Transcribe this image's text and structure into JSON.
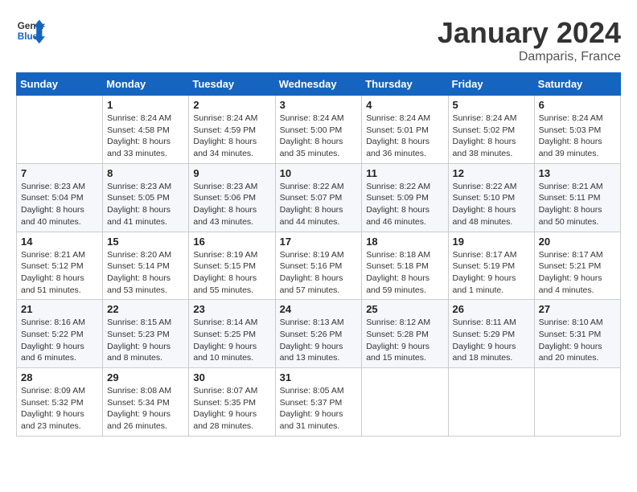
{
  "logo": {
    "general": "General",
    "blue": "Blue"
  },
  "header": {
    "month": "January 2024",
    "location": "Damparis, France"
  },
  "weekdays": [
    "Sunday",
    "Monday",
    "Tuesday",
    "Wednesday",
    "Thursday",
    "Friday",
    "Saturday"
  ],
  "weeks": [
    [
      {
        "day": null,
        "sunrise": null,
        "sunset": null,
        "daylight": null
      },
      {
        "day": "1",
        "sunrise": "Sunrise: 8:24 AM",
        "sunset": "Sunset: 4:58 PM",
        "daylight": "Daylight: 8 hours and 33 minutes."
      },
      {
        "day": "2",
        "sunrise": "Sunrise: 8:24 AM",
        "sunset": "Sunset: 4:59 PM",
        "daylight": "Daylight: 8 hours and 34 minutes."
      },
      {
        "day": "3",
        "sunrise": "Sunrise: 8:24 AM",
        "sunset": "Sunset: 5:00 PM",
        "daylight": "Daylight: 8 hours and 35 minutes."
      },
      {
        "day": "4",
        "sunrise": "Sunrise: 8:24 AM",
        "sunset": "Sunset: 5:01 PM",
        "daylight": "Daylight: 8 hours and 36 minutes."
      },
      {
        "day": "5",
        "sunrise": "Sunrise: 8:24 AM",
        "sunset": "Sunset: 5:02 PM",
        "daylight": "Daylight: 8 hours and 38 minutes."
      },
      {
        "day": "6",
        "sunrise": "Sunrise: 8:24 AM",
        "sunset": "Sunset: 5:03 PM",
        "daylight": "Daylight: 8 hours and 39 minutes."
      }
    ],
    [
      {
        "day": "7",
        "sunrise": "Sunrise: 8:23 AM",
        "sunset": "Sunset: 5:04 PM",
        "daylight": "Daylight: 8 hours and 40 minutes."
      },
      {
        "day": "8",
        "sunrise": "Sunrise: 8:23 AM",
        "sunset": "Sunset: 5:05 PM",
        "daylight": "Daylight: 8 hours and 41 minutes."
      },
      {
        "day": "9",
        "sunrise": "Sunrise: 8:23 AM",
        "sunset": "Sunset: 5:06 PM",
        "daylight": "Daylight: 8 hours and 43 minutes."
      },
      {
        "day": "10",
        "sunrise": "Sunrise: 8:22 AM",
        "sunset": "Sunset: 5:07 PM",
        "daylight": "Daylight: 8 hours and 44 minutes."
      },
      {
        "day": "11",
        "sunrise": "Sunrise: 8:22 AM",
        "sunset": "Sunset: 5:09 PM",
        "daylight": "Daylight: 8 hours and 46 minutes."
      },
      {
        "day": "12",
        "sunrise": "Sunrise: 8:22 AM",
        "sunset": "Sunset: 5:10 PM",
        "daylight": "Daylight: 8 hours and 48 minutes."
      },
      {
        "day": "13",
        "sunrise": "Sunrise: 8:21 AM",
        "sunset": "Sunset: 5:11 PM",
        "daylight": "Daylight: 8 hours and 50 minutes."
      }
    ],
    [
      {
        "day": "14",
        "sunrise": "Sunrise: 8:21 AM",
        "sunset": "Sunset: 5:12 PM",
        "daylight": "Daylight: 8 hours and 51 minutes."
      },
      {
        "day": "15",
        "sunrise": "Sunrise: 8:20 AM",
        "sunset": "Sunset: 5:14 PM",
        "daylight": "Daylight: 8 hours and 53 minutes."
      },
      {
        "day": "16",
        "sunrise": "Sunrise: 8:19 AM",
        "sunset": "Sunset: 5:15 PM",
        "daylight": "Daylight: 8 hours and 55 minutes."
      },
      {
        "day": "17",
        "sunrise": "Sunrise: 8:19 AM",
        "sunset": "Sunset: 5:16 PM",
        "daylight": "Daylight: 8 hours and 57 minutes."
      },
      {
        "day": "18",
        "sunrise": "Sunrise: 8:18 AM",
        "sunset": "Sunset: 5:18 PM",
        "daylight": "Daylight: 8 hours and 59 minutes."
      },
      {
        "day": "19",
        "sunrise": "Sunrise: 8:17 AM",
        "sunset": "Sunset: 5:19 PM",
        "daylight": "Daylight: 9 hours and 1 minute."
      },
      {
        "day": "20",
        "sunrise": "Sunrise: 8:17 AM",
        "sunset": "Sunset: 5:21 PM",
        "daylight": "Daylight: 9 hours and 4 minutes."
      }
    ],
    [
      {
        "day": "21",
        "sunrise": "Sunrise: 8:16 AM",
        "sunset": "Sunset: 5:22 PM",
        "daylight": "Daylight: 9 hours and 6 minutes."
      },
      {
        "day": "22",
        "sunrise": "Sunrise: 8:15 AM",
        "sunset": "Sunset: 5:23 PM",
        "daylight": "Daylight: 9 hours and 8 minutes."
      },
      {
        "day": "23",
        "sunrise": "Sunrise: 8:14 AM",
        "sunset": "Sunset: 5:25 PM",
        "daylight": "Daylight: 9 hours and 10 minutes."
      },
      {
        "day": "24",
        "sunrise": "Sunrise: 8:13 AM",
        "sunset": "Sunset: 5:26 PM",
        "daylight": "Daylight: 9 hours and 13 minutes."
      },
      {
        "day": "25",
        "sunrise": "Sunrise: 8:12 AM",
        "sunset": "Sunset: 5:28 PM",
        "daylight": "Daylight: 9 hours and 15 minutes."
      },
      {
        "day": "26",
        "sunrise": "Sunrise: 8:11 AM",
        "sunset": "Sunset: 5:29 PM",
        "daylight": "Daylight: 9 hours and 18 minutes."
      },
      {
        "day": "27",
        "sunrise": "Sunrise: 8:10 AM",
        "sunset": "Sunset: 5:31 PM",
        "daylight": "Daylight: 9 hours and 20 minutes."
      }
    ],
    [
      {
        "day": "28",
        "sunrise": "Sunrise: 8:09 AM",
        "sunset": "Sunset: 5:32 PM",
        "daylight": "Daylight: 9 hours and 23 minutes."
      },
      {
        "day": "29",
        "sunrise": "Sunrise: 8:08 AM",
        "sunset": "Sunset: 5:34 PM",
        "daylight": "Daylight: 9 hours and 26 minutes."
      },
      {
        "day": "30",
        "sunrise": "Sunrise: 8:07 AM",
        "sunset": "Sunset: 5:35 PM",
        "daylight": "Daylight: 9 hours and 28 minutes."
      },
      {
        "day": "31",
        "sunrise": "Sunrise: 8:05 AM",
        "sunset": "Sunset: 5:37 PM",
        "daylight": "Daylight: 9 hours and 31 minutes."
      },
      {
        "day": null,
        "sunrise": null,
        "sunset": null,
        "daylight": null
      },
      {
        "day": null,
        "sunrise": null,
        "sunset": null,
        "daylight": null
      },
      {
        "day": null,
        "sunrise": null,
        "sunset": null,
        "daylight": null
      }
    ]
  ]
}
